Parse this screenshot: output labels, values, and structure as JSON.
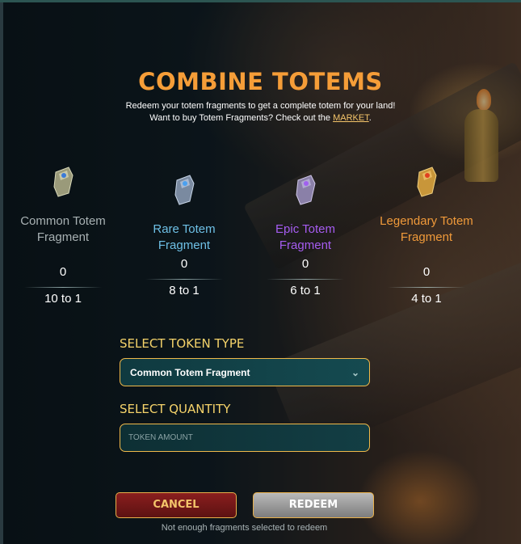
{
  "title": "COMBINE TOTEMS",
  "subtitle": {
    "line1": "Redeem your totem fragments to get a complete totem for your land!",
    "line2_prefix": "Want to buy Totem Fragments? Check out the ",
    "market_link": "MARKET",
    "line2_suffix": "."
  },
  "fragments": [
    {
      "name": "Common Totem Fragment",
      "count": "0",
      "ratio": "10 to 1",
      "color": "#a8b1b3"
    },
    {
      "name": "Rare Totem Fragment",
      "count": "0",
      "ratio": "8 to 1",
      "color": "#6ec0e6"
    },
    {
      "name": "Epic Totem Fragment",
      "count": "0",
      "ratio": "6 to 1",
      "color": "#a55cf0"
    },
    {
      "name": "Legendary Totem Fragment",
      "count": "0",
      "ratio": "4 to 1",
      "color": "#f09a3a"
    }
  ],
  "form": {
    "token_type_label": "SELECT TOKEN TYPE",
    "token_type_value": "Common Totem Fragment",
    "quantity_label": "SELECT QUANTITY",
    "quantity_placeholder": "TOKEN AMOUNT"
  },
  "buttons": {
    "cancel": "CANCEL",
    "redeem": "REDEEM"
  },
  "status_note": "Not enough fragments selected to redeem",
  "colors": {
    "title": "#f59d38",
    "accent_gold": "#f5d36a",
    "border_gold": "#f0b94a",
    "cancel_bg": "#8a1e1e",
    "redeem_bg": "#9a9a9a"
  }
}
